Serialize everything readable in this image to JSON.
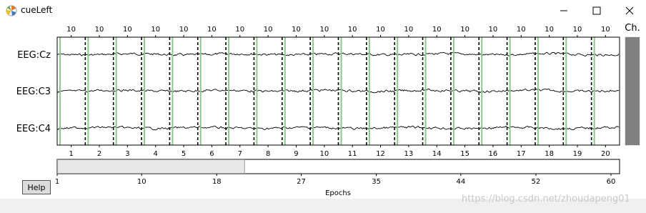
{
  "window": {
    "title": "cueLeft",
    "icons": [
      "matplotlib-logo-icon",
      "minimize-icon",
      "maximize-icon",
      "close-icon"
    ]
  },
  "browser": {
    "channel_header": "Ch.",
    "channels": [
      "EEG:Cz",
      "EEG:C3",
      "EEG:C4"
    ],
    "epoch_count_labels": [
      "10",
      "10",
      "10",
      "10",
      "10",
      "10",
      "10",
      "10",
      "10",
      "10",
      "10",
      "10",
      "10",
      "10",
      "10",
      "10",
      "10",
      "10",
      "10",
      "10"
    ],
    "epoch_numbers": [
      "1",
      "2",
      "3",
      "4",
      "5",
      "6",
      "7",
      "8",
      "9",
      "10",
      "11",
      "12",
      "13",
      "14",
      "15",
      "16",
      "17",
      "18",
      "19",
      "20"
    ],
    "help_label": "Help",
    "epochs_axis": {
      "ticks": [
        "1",
        "10",
        "18",
        "27",
        "35",
        "44",
        "52",
        "60"
      ],
      "label": "Epochs",
      "visible_fraction": 0.333
    },
    "colors": {
      "trace": "#000000",
      "event_marker": "#8fc78f",
      "boundary": "#000000",
      "scroll_fill": "#808080",
      "epoch_fill": "#e8e8e8"
    }
  },
  "watermark": "https://blog.csdn.net/zhoudapeng01"
}
